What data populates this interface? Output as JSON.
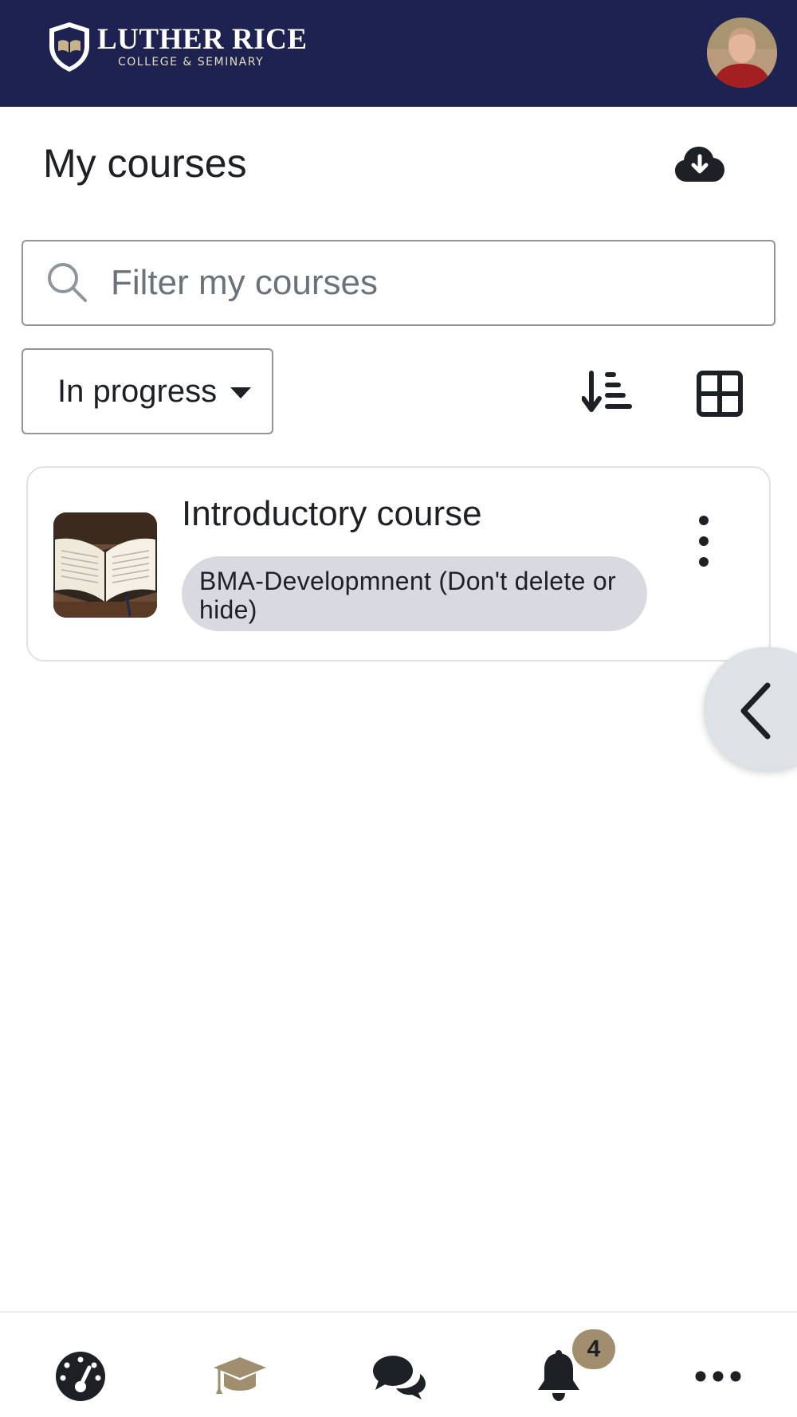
{
  "header": {
    "logo": {
      "name": "LUTHER RICE",
      "subtitle": "COLLEGE & SEMINARY"
    },
    "avatar_icon": "user-avatar"
  },
  "page": {
    "title": "My courses",
    "download_icon": "cloud-download-icon"
  },
  "search": {
    "placeholder": "Filter my courses",
    "value": ""
  },
  "filter": {
    "selected": "In progress"
  },
  "toolbar": {
    "sort_icon": "sort-descending-icon",
    "view_icon": "grid-view-icon"
  },
  "courses": [
    {
      "title": "Introductory course",
      "category": "BMA-Developmnent (Don't delete or hide)",
      "image": "open-book"
    }
  ],
  "bottom_nav": {
    "items": [
      {
        "icon": "dashboard-icon"
      },
      {
        "icon": "graduation-cap-icon",
        "active": true
      },
      {
        "icon": "messages-icon"
      },
      {
        "icon": "bell-icon"
      },
      {
        "icon": "more-icon"
      }
    ],
    "notification_count": "4"
  },
  "colors": {
    "header_bg": "#1e2251",
    "active_nav": "#a08e6e",
    "badge_bg": "#a08e6e",
    "category_pill": "#d9d9e2"
  }
}
